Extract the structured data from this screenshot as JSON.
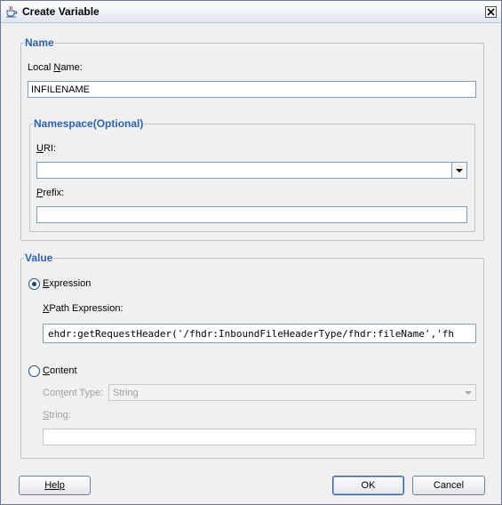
{
  "window": {
    "title": "Create Variable",
    "icon": "java-cup-icon"
  },
  "name_group": {
    "legend": "Name",
    "local_name_label": "Local Name:",
    "local_name_value": "INFILENAME",
    "namespace": {
      "legend": "Namespace(Optional)",
      "uri_label": "URI:",
      "uri_value": "",
      "prefix_label": "Prefix:",
      "prefix_value": ""
    }
  },
  "value_group": {
    "legend": "Value",
    "expression_label": "Expression",
    "expression_selected": true,
    "xpath_label": "XPath Expression:",
    "xpath_value": "ehdr:getRequestHeader('/fhdr:InboundFileHeaderType/fhdr:fileName','fh",
    "content_label": "Content",
    "content_selected": false,
    "content_type_label": "Content Type:",
    "content_type_value": "String",
    "string_label": "String:",
    "string_value": ""
  },
  "buttons": {
    "help": "Help",
    "ok": "OK",
    "cancel": "Cancel"
  }
}
